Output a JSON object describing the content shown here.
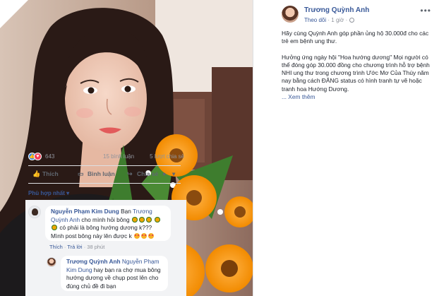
{
  "post": {
    "author": "Trương Quỳnh Anh",
    "follow_label": "Theo dõi",
    "time": "1 giờ",
    "more_label": "•••",
    "text_p1": "Hãy cùng Quỳnh Anh góp phần ủng hộ 30.000đ cho các trẻ em bệnh ung thư.",
    "text_p2": "Hưởng ứng ngày hội \"Hoa hướng dương\" Mọi người có thể đóng góp 30.000 đồng cho chương trình hỗ trợ bệnh NHI ung thư trong chương trình Ước Mơ Của Thúy năm nay bằng cách ĐĂNG status có hình tranh tự vẽ hoặc tranh hoa Hướng Dương.",
    "see_more": "... Xem thêm"
  },
  "stats": {
    "reactions": "643",
    "comments": "15 bình luận",
    "shares": "5 lượt chia sẻ"
  },
  "actions": {
    "like": "Thích",
    "comment": "Bình luận",
    "share": "Chia sẻ"
  },
  "comments_filter": "Phù hợp nhất ▾",
  "comments": [
    {
      "author": "Nguyễn Phạm Kim Dung",
      "prefix": "Bạn",
      "mention": "Trương Quỳnh Anh",
      "text_a": "cho mình hỏi bông",
      "text_b": "có phải là bông hướng dương k???",
      "text_c": "Mình post bông này lên được k",
      "like_label": "Thích",
      "reply_label": "Trả lời",
      "time": "38 phút"
    },
    {
      "author": "Trương Quỳnh Anh",
      "mention": "Nguyễn Phạm Kim Dung",
      "text": "hay bạn ra chợ mua bông hướng dương về chụp post lên cho đúng chủ đề đi bạn"
    }
  ],
  "icons": {
    "like": "thumbs-up-icon",
    "comment": "speech-bubble-icon",
    "share": "share-arrow-icon",
    "globe": "globe-icon",
    "more": "more-dots-icon"
  },
  "colors": {
    "link": "#385898",
    "like_blue": "#2d88ff",
    "love_red": "#f33e58",
    "muted": "#90949c",
    "sunflower": "#f0a500"
  }
}
